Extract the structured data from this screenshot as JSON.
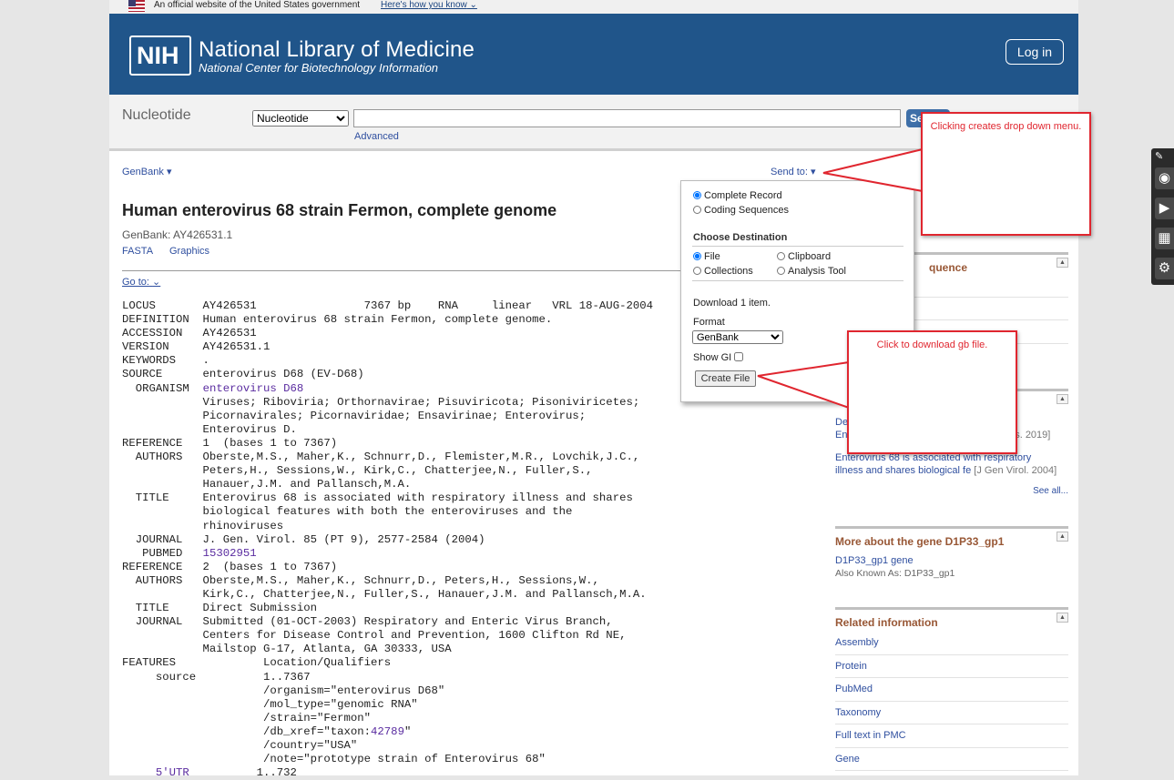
{
  "banner": {
    "official_text": "An official website of the United States government",
    "how_link": "Here's how you know"
  },
  "header": {
    "logo_text": "NIH",
    "title": "National Library of Medicine",
    "subtitle": "National Center for Biotechnology Information",
    "login_label": "Log in"
  },
  "search": {
    "db_label": "Nucleotide",
    "db_selected": "Nucleotide",
    "search_value": "",
    "search_button": "Se",
    "advanced_link": "Advanced"
  },
  "record_nav": {
    "format_menu": "GenBank",
    "send_to": "Send to:"
  },
  "record": {
    "title": "Human enterovirus 68 strain Fermon, complete genome",
    "accession_line": "GenBank: AY426531.1",
    "fasta_link": "FASTA",
    "graphics_link": "Graphics",
    "goto_link": "Go to:",
    "lines": [
      {
        "text": "LOCUS       AY426531                7367 bp    RNA     linear   VRL 18-AUG-2004"
      },
      {
        "text": "DEFINITION  Human enterovirus 68 strain Fermon, complete genome."
      },
      {
        "text": "ACCESSION   AY426531"
      },
      {
        "text": "VERSION     AY426531.1"
      },
      {
        "text": "KEYWORDS    ."
      },
      {
        "text": "SOURCE      enterovirus D68 (EV-D68)"
      },
      {
        "text": "  ORGANISM  ",
        "link": "enterovirus D68"
      },
      {
        "text": "            Viruses; Riboviria; Orthornavirae; Pisuviricota; Pisoniviricetes;"
      },
      {
        "text": "            Picornavirales; Picornaviridae; Ensavirinae; Enterovirus;"
      },
      {
        "text": "            Enterovirus D."
      },
      {
        "text": "REFERENCE   1  (bases 1 to 7367)"
      },
      {
        "text": "  AUTHORS   Oberste,M.S., Maher,K., Schnurr,D., Flemister,M.R., Lovchik,J.C.,"
      },
      {
        "text": "            Peters,H., Sessions,W., Kirk,C., Chatterjee,N., Fuller,S.,"
      },
      {
        "text": "            Hanauer,J.M. and Pallansch,M.A."
      },
      {
        "text": "  TITLE     Enterovirus 68 is associated with respiratory illness and shares"
      },
      {
        "text": "            biological features with both the enteroviruses and the"
      },
      {
        "text": "            rhinoviruses"
      },
      {
        "text": "  JOURNAL   J. Gen. Virol. 85 (PT 9), 2577-2584 (2004)"
      },
      {
        "text": "   PUBMED   ",
        "link": "15302951"
      },
      {
        "text": "REFERENCE   2  (bases 1 to 7367)"
      },
      {
        "text": "  AUTHORS   Oberste,M.S., Maher,K., Schnurr,D., Peters,H., Sessions,W.,"
      },
      {
        "text": "            Kirk,C., Chatterjee,N., Fuller,S., Hanauer,J.M. and Pallansch,M.A."
      },
      {
        "text": "  TITLE     Direct Submission"
      },
      {
        "text": "  JOURNAL   Submitted (01-OCT-2003) Respiratory and Enteric Virus Branch,"
      },
      {
        "text": "            Centers for Disease Control and Prevention, 1600 Clifton Rd NE,"
      },
      {
        "text": "            Mailstop G-17, Atlanta, GA 30333, USA"
      },
      {
        "text": "FEATURES             Location/Qualifiers"
      },
      {
        "text": "     source          1..7367"
      },
      {
        "text": "                     /organism=\"enterovirus D68\""
      },
      {
        "text": "                     /mol_type=\"genomic RNA\""
      },
      {
        "text": "                     /strain=\"Fermon\""
      },
      {
        "text": "                     /db_xref=\"taxon:",
        "link": "42789",
        "after": "\""
      },
      {
        "text": "                     /country=\"USA\""
      },
      {
        "text": "                     /note=\"prototype strain of Enterovirus 68\""
      },
      {
        "text": "     ",
        "link": "5'UTR",
        "after": "          1..732"
      }
    ]
  },
  "send_panel": {
    "complete_record": "Complete Record",
    "coding_sequences": "Coding Sequences",
    "choose_destination": "Choose Destination",
    "file": "File",
    "clipboard": "Clipboard",
    "collections": "Collections",
    "analysis_tool": "Analysis Tool",
    "download_count": "Download 1 item.",
    "format_label": "Format",
    "format_value": "GenBank",
    "show_gi": "Show GI",
    "create_file": "Create File"
  },
  "callouts": {
    "top": "Clicking creates drop down menu.",
    "bottom": "Click to download gb file."
  },
  "sidebar": {
    "analyze_title": "quence",
    "articles_title": "me",
    "articles": [
      {
        "title": "De",
        "tail": "an",
        "line2": "En",
        "cite": "uses. 2019]"
      },
      {
        "title": "Enterovirus 68 is associated with respiratory",
        "line2": "illness and shares biological fe",
        "cite": "[J Gen Virol. 2004]"
      }
    ],
    "see_all": "See all...",
    "gene_title": "More about the gene D1P33_gp1",
    "gene_link": "D1P33_gp1 gene",
    "gene_aka": "Also Known As: D1P33_gp1",
    "related_title": "Related information",
    "related": [
      "Assembly",
      "Protein",
      "PubMed",
      "Taxonomy",
      "Full text in PMC",
      "Gene"
    ]
  },
  "colors": {
    "header_bg": "#20558a",
    "callout_border": "#e0262f",
    "section_title": "#985735"
  }
}
